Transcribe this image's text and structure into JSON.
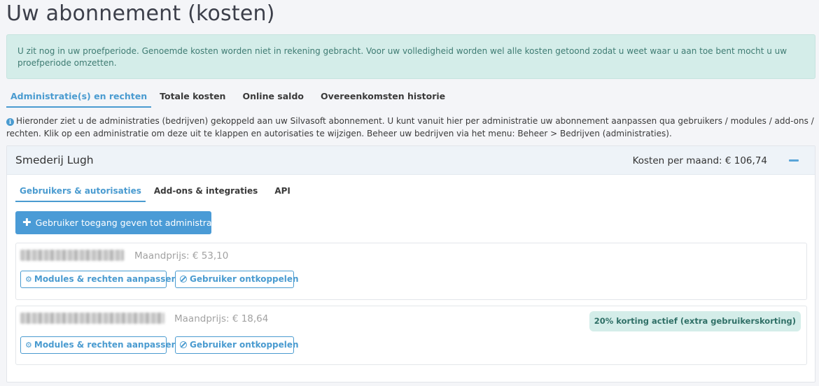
{
  "page": {
    "title": "Uw abonnement (kosten)"
  },
  "alert": {
    "text": "U zit nog in uw proefperiode. Genoemde kosten worden niet in rekening gebracht. Voor uw volledigheid worden wel alle kosten getoond zodat u weet waar u aan toe bent mocht u uw proefperiode omzetten."
  },
  "tabs": [
    {
      "label": "Administratie(s) en rechten",
      "active": true
    },
    {
      "label": "Totale kosten",
      "active": false
    },
    {
      "label": "Online saldo",
      "active": false
    },
    {
      "label": "Overeenkomsten historie",
      "active": false
    }
  ],
  "info": {
    "icon": "info-circle-icon",
    "text": "Hieronder ziet u de administraties (bedrijven) gekoppeld aan uw Silvasoft abonnement. U kunt vanuit hier per administratie uw abonnement aanpassen qua gebruikers / modules / add-ons / rechten. Klik op een administratie om deze uit te klappen en autorisaties te wijzigen. Beheer uw bedrijven via het menu: Beheer > Bedrijven (administraties)."
  },
  "company": {
    "name": "Smederij Lugh",
    "cost_label": "Kosten per maand: € 106,74",
    "subtabs": [
      {
        "label": "Gebruikers & autorisaties",
        "active": true
      },
      {
        "label": "Add-ons & integraties",
        "active": false
      },
      {
        "label": "API",
        "active": false
      }
    ],
    "add_user_label": "Gebruiker toegang geven tot administratie",
    "users": [
      {
        "price": "Maandprijs: € 53,10",
        "modules_button": "Modules & rechten aanpassen",
        "disconnect_button": "Gebruiker ontkoppelen"
      },
      {
        "price": "Maandprijs: € 18,64",
        "badge": "20% korting actief (extra gebruikerskorting)",
        "modules_button": "Modules & rechten aanpassen",
        "disconnect_button": "Gebruiker ontkoppelen"
      }
    ]
  },
  "colors": {
    "accent": "#4a9bd0",
    "alert_bg": "#d4ede9",
    "alert_text": "#3e7b72"
  }
}
